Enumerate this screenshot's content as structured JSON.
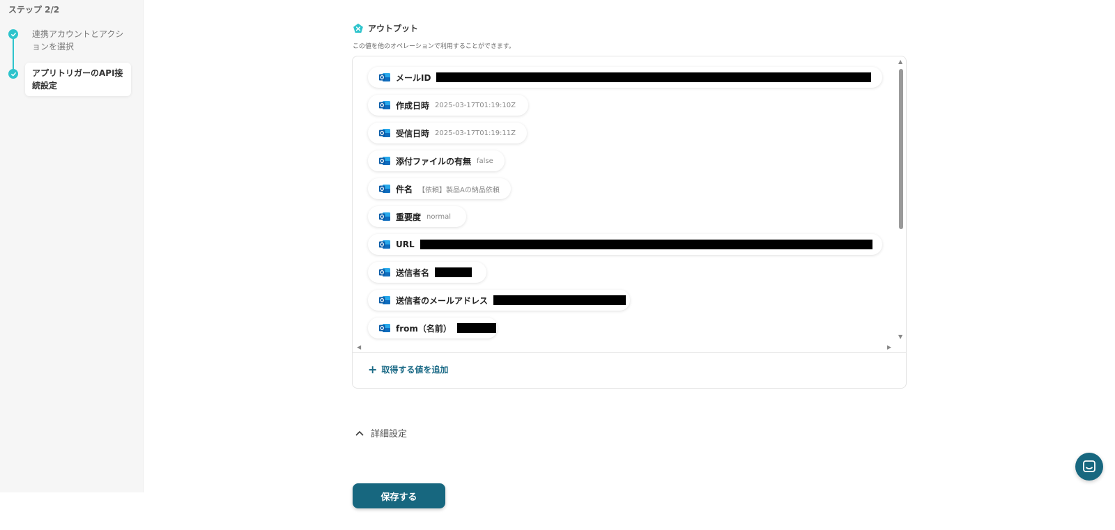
{
  "sidebar": {
    "step_title": "ステップ 2/2",
    "steps": [
      {
        "label": "連携アカウントとアクションを選択",
        "state": "done"
      },
      {
        "label": "アプリトリガーのAPI接続設定",
        "state": "active"
      }
    ]
  },
  "output": {
    "title": "アウトプット",
    "description": "この値を他のオペレーションで利用することができます。",
    "items": [
      {
        "key": "メールID",
        "value": "",
        "redacted": true
      },
      {
        "key": "作成日時",
        "value": "2025-03-17T01:19:10Z",
        "redacted": false
      },
      {
        "key": "受信日時",
        "value": "2025-03-17T01:19:11Z",
        "redacted": false
      },
      {
        "key": "添付ファイルの有無",
        "value": "false",
        "redacted": false
      },
      {
        "key": "件名",
        "value": "【依頼】製品Aの納品依頼",
        "redacted": false
      },
      {
        "key": "重要度",
        "value": "normal",
        "redacted": false
      },
      {
        "key": "URL",
        "value": "",
        "redacted": true
      },
      {
        "key": "送信者名",
        "value": "",
        "redacted": true
      },
      {
        "key": "送信者のメールアドレス",
        "value": "",
        "redacted": true
      },
      {
        "key": "from（名前）",
        "value": "",
        "redacted": true
      }
    ],
    "add_label": "取得する値を追加"
  },
  "detail_settings": {
    "label": "詳細設定"
  },
  "save_button": {
    "label": "保存する"
  },
  "colors": {
    "accent": "#2ec4cc",
    "primary": "#17677f",
    "link": "#1b6a86",
    "outlook_blue": "#0f6cbd"
  }
}
